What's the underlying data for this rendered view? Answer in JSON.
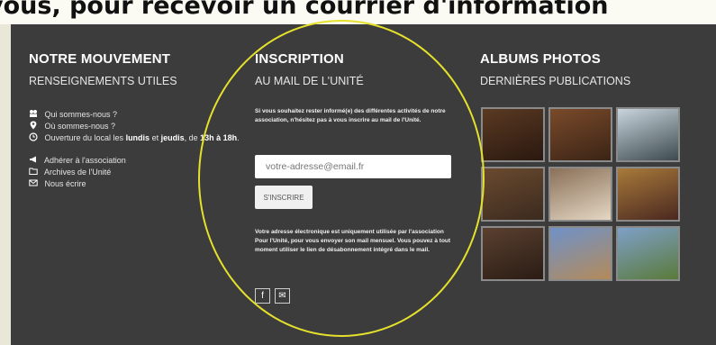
{
  "banner_text": "vous, pour recevoir un courrier d'information",
  "columns": {
    "movement": {
      "title": "NOTRE MOUVEMENT",
      "subtitle": "RENSEIGNEMENTS UTILES",
      "items": [
        {
          "icon": "people-icon",
          "text": "Qui sommes-nous ?"
        },
        {
          "icon": "map-pin-icon",
          "text": "Où sommes-nous ?"
        },
        {
          "icon": "clock-icon",
          "text_parts": [
            "Ouverture du local les ",
            "lundis",
            " et ",
            "jeudis",
            ", de ",
            "13h à 18h",
            "."
          ]
        },
        {
          "icon": "megaphone-icon",
          "text": "Adhérer à l'association"
        },
        {
          "icon": "folder-icon",
          "text": "Archives de l'Unité"
        },
        {
          "icon": "envelope-icon",
          "text": "Nous écrire"
        }
      ]
    },
    "inscription": {
      "title": "INSCRIPTION",
      "subtitle": "AU MAIL DE L'UNITÉ",
      "intro": "Si vous souhaitez rester informé(e) des différentes activités de notre association, n'hésitez pas à vous inscrire au mail de l'Unité.",
      "email_placeholder": "votre-adresse@email.fr",
      "submit_label": "S'INSCRIRE",
      "notice": "Votre adresse électronique est uniquement utilisée par l'association Pour l'Unité, pour vous envoyer son mail mensuel. Vous pouvez à tout moment utiliser le lien de désabonnement intégré dans le mail.",
      "social": [
        {
          "icon": "facebook-icon",
          "glyph": "f"
        },
        {
          "icon": "email-icon",
          "glyph": "✉"
        }
      ]
    },
    "albums": {
      "title": "ALBUMS PHOTOS",
      "subtitle": "DERNIÈRES PUBLICATIONS",
      "photos": [
        {
          "colors": [
            "#5a3a22",
            "#2a1810"
          ]
        },
        {
          "colors": [
            "#7a4a2a",
            "#3a2416"
          ]
        },
        {
          "colors": [
            "#c9d4dc",
            "#3d4a4f"
          ]
        },
        {
          "colors": [
            "#6a4a2e",
            "#3b2a1f"
          ]
        },
        {
          "colors": [
            "#8a7058",
            "#e4d7c4"
          ]
        },
        {
          "colors": [
            "#a87a3a",
            "#4a2820"
          ]
        },
        {
          "colors": [
            "#5a4030",
            "#2a1c14"
          ]
        },
        {
          "colors": [
            "#6f92c9",
            "#b38a5a"
          ]
        },
        {
          "colors": [
            "#7ea0c8",
            "#5a7a3a"
          ]
        }
      ]
    }
  },
  "colors": {
    "panel_bg": "#3c3c3c",
    "annotation_circle": "#e5e02b"
  }
}
